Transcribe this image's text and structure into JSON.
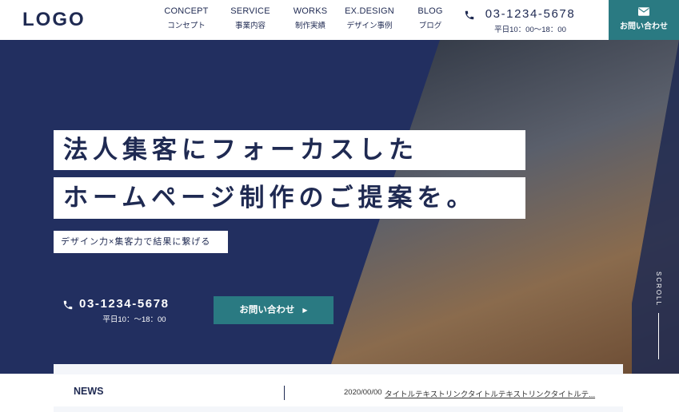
{
  "header": {
    "logo": "LOGO",
    "nav": [
      {
        "en": "CONCEPT",
        "jp": "コンセプト"
      },
      {
        "en": "SERVICE",
        "jp": "事業内容"
      },
      {
        "en": "WORKS",
        "jp": "制作実績"
      },
      {
        "en": "EX.DESIGN",
        "jp": "デザイン事例"
      },
      {
        "en": "BLOG",
        "jp": "ブログ"
      }
    ],
    "tel": "03-1234-5678",
    "hours": "平日10：00〜18：00",
    "contact_label": "お問い合わせ"
  },
  "hero": {
    "headline_1": "法人集客にフォーカスした",
    "headline_2": "ホームページ制作のご提案を。",
    "subtitle": "デザイン力×集客力で結果に繋げる",
    "tel": "03-1234-5678",
    "hours": "平日10：〜18：00",
    "cta_label": "お問い合わせ",
    "scroll_label": "SCROLL"
  },
  "news": {
    "label": "NEWS",
    "date": "2020/00/00",
    "link_text": "タイトルテキストリンクタイトルテキストリンクタイトルテ..."
  },
  "colors": {
    "navy": "#1f2a52",
    "teal": "#2a7a82"
  },
  "icons": {
    "phone": "phone-icon",
    "mail": "mail-icon",
    "arrow": "arrow-right-icon"
  }
}
